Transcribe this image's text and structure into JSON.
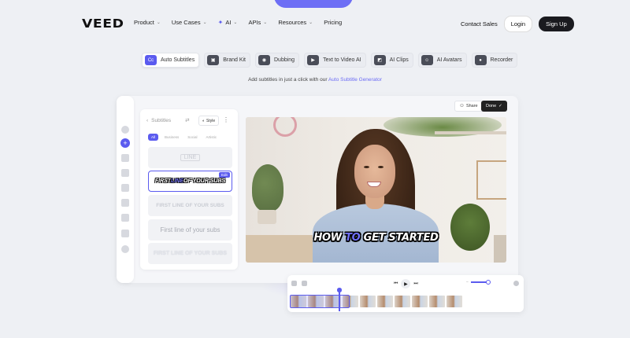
{
  "nav": {
    "logo": "VEED",
    "links": [
      {
        "label": "Product",
        "chevron": true
      },
      {
        "label": "Use Cases",
        "chevron": true
      },
      {
        "label": "AI",
        "chevron": true,
        "icon": "sparkle-icon"
      },
      {
        "label": "APIs",
        "chevron": true
      },
      {
        "label": "Resources",
        "chevron": true
      },
      {
        "label": "Pricing",
        "chevron": false
      }
    ],
    "contact_sales": "Contact Sales",
    "login": "Login",
    "signup": "Sign Up"
  },
  "tabs": [
    {
      "label": "Auto Subtitles",
      "icon": "Cc",
      "active": true
    },
    {
      "label": "Brand Kit",
      "icon": "▣",
      "active": false
    },
    {
      "label": "Dubbing",
      "icon": "◉",
      "active": false
    },
    {
      "label": "Text to Video AI",
      "icon": "▶",
      "active": false
    },
    {
      "label": "AI Clips",
      "icon": "◩",
      "active": false
    },
    {
      "label": "AI Avatars",
      "icon": "☺",
      "active": false
    },
    {
      "label": "Recorder",
      "icon": "●",
      "active": false
    }
  ],
  "tagline": {
    "text": "Add subtitles in just a click with our ",
    "link": "Auto Subtitle Generator"
  },
  "editor": {
    "share": "Share",
    "done": "Done",
    "subtitles_title": "Subtitles",
    "style": "Style",
    "filters": [
      "All",
      "Business",
      "Social",
      "Artistic"
    ],
    "styles": [
      {
        "text": "LINE"
      },
      {
        "pre": "FIRST ",
        "hl": "LINE",
        "post": " OF YOUR SUBS",
        "badge": "Edit"
      },
      {
        "text": "FIRST LINE OF YOUR SUBS"
      },
      {
        "text": "First line of your subs"
      },
      {
        "text": "FIRST LINE OF YOUR SUBS"
      }
    ],
    "caption": {
      "pre": "HOW ",
      "hl": "TO",
      "post": " GET STARTED"
    }
  },
  "colors": {
    "accent": "#5b5bef",
    "dark": "#1a1a1f"
  }
}
